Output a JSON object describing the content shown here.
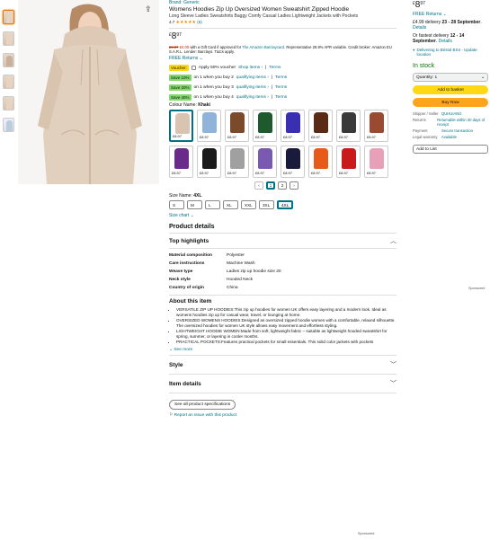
{
  "product": {
    "brand": "Brand: Generic",
    "title": "Womens Hoodies Zip Up Oversized Women Sweatshirt Zipped Hoodie",
    "subtitle": "Long Sleeve Ladies Sweatshirts Baggy Comfy Casual Ladies Lightweight Jackets with Pockets",
    "rating_value": "4.7",
    "rating_count": "(6)",
    "price_symbol": "£",
    "price_whole": "8",
    "price_fraction": "97",
    "giftcard_old": "£8.97",
    "giftcard_new": "£0.00",
    "giftcard_text": "with a Gift Card if approved for",
    "giftcard_link": "The Amazon Barclaycard",
    "giftcard_tail": ". Representative 28.9% APR variable. Credit broker: Amazon EU S.A.R.L. Lender: Barclays. T&Cs apply.",
    "returns": "FREE Returns"
  },
  "promos": [
    {
      "badge": "Voucher:",
      "type": "voucher",
      "text": "Apply 50% voucher",
      "link1": "Shop items ›",
      "link2": "Terms"
    },
    {
      "badge": "Save 10%",
      "type": "save",
      "text": "on 1 when you buy 2",
      "link1": "qualifying items ›",
      "link2": "Terms"
    },
    {
      "badge": "Save 20%",
      "type": "save",
      "text": "on 1 when you buy 3",
      "link1": "qualifying items ›",
      "link2": "Terms"
    },
    {
      "badge": "Save 40%",
      "type": "save",
      "text": "on 1 when you buy 4",
      "link1": "qualifying items ›",
      "link2": "Terms"
    }
  ],
  "colour": {
    "label": "Colour Name:",
    "value": "Khaki"
  },
  "swatches": [
    {
      "color": "#d9c4b0",
      "price": "£8.97"
    },
    {
      "color": "#8fb3d9",
      "price": "£8.97"
    },
    {
      "color": "#7a4a2a",
      "price": "£8.97"
    },
    {
      "color": "#1f5a2e",
      "price": "£8.97"
    },
    {
      "color": "#3a2fb0",
      "price": "£8.97"
    },
    {
      "color": "#5a2a15",
      "price": "£8.97"
    },
    {
      "color": "#3a3a3a",
      "price": "£8.97"
    },
    {
      "color": "#9a4a30",
      "price": "£8.97"
    },
    {
      "color": "#6a2a8a",
      "price": "£8.97"
    },
    {
      "color": "#1a1a1a",
      "price": "£8.97"
    },
    {
      "color": "#a0a0a0",
      "price": "£8.97"
    },
    {
      "color": "#7a5ab0",
      "price": "£8.97"
    },
    {
      "color": "#1a1a3a",
      "price": "£8.97"
    },
    {
      "color": "#e85a1a",
      "price": "£8.97"
    },
    {
      "color": "#c81a1a",
      "price": "£8.97"
    },
    {
      "color": "#e8a0b8",
      "price": "£8.97"
    }
  ],
  "pager": {
    "prev": "‹",
    "pages": [
      "1",
      "2"
    ],
    "next": "›"
  },
  "size": {
    "label": "Size Name:",
    "value": "4XL",
    "options": [
      "S",
      "M",
      "L",
      "XL",
      "XXL",
      "3XL",
      "4XL"
    ],
    "chart": "Size chart"
  },
  "details": {
    "heading": "Product details",
    "top_highlights": "Top highlights",
    "rows": [
      {
        "k": "Material composition",
        "v": "Polyester"
      },
      {
        "k": "Care instructions",
        "v": "Machine Wash"
      },
      {
        "k": "Weave type",
        "v": "Ladies zip up hoodie size 20"
      },
      {
        "k": "Neck style",
        "v": "Hooded Neck"
      },
      {
        "k": "Country of origin",
        "v": "China"
      }
    ],
    "sponsored": "Sponsored"
  },
  "about": {
    "heading": "About this item",
    "bullets": [
      "VERSATILE ZIP UP HOODIES:This zip up hoodies for women UK offers easy layering and a modern look. Ideal as womens hoodies zip up for casual wear, travel, or lounging at home.",
      "OVERSIZED WOMENS HOODIES:Designed as oversized zipped hoodie women with a comfortable, relaxed silhouette. The oversized hoodies for women UK style allows easy movement and effortless styling.",
      "LIGHTWEIGHT HOODIE WOMEN:Made from soft, lightweight fabric – suitable as lightweight hooded sweatshirt for spring, summer, or layering in cooler months.",
      "PRACTICAL POCKETS:Features practical pockets for small essentials. This solid color jackets with pockets"
    ],
    "see_more": "See more"
  },
  "sections": {
    "style": "Style",
    "item_details": "Item details"
  },
  "spec_button": "See all product specifications",
  "report": "Report an issue with this product",
  "sponsored_bottom": "Sponsored",
  "buybox": {
    "price_symbol": "£",
    "price_whole": "8",
    "price_fraction": "97",
    "returns": "FREE Returns",
    "delivery_pre": "£4.99 delivery",
    "delivery_date": "23 - 28 September",
    "delivery_link": "Details",
    "fast_pre": "Or fastest delivery",
    "fast_date": "12 - 14 September",
    "fast_link": "Details",
    "location": "Delivering to Bristol BS4 - Update location",
    "stock": "In stock",
    "quantity": "Quantity: 1",
    "add_basket": "Add to basket",
    "buy_now": "Buy Now",
    "info": [
      {
        "k": "Shipper / Seller",
        "v": "QUHUIANG"
      },
      {
        "k": "Returns",
        "v": "Returnable within 30 days of receipt"
      },
      {
        "k": "Payment",
        "v": "Secure transaction"
      },
      {
        "k": "Legal warranty",
        "v": "Available"
      }
    ],
    "add_list": "Add to List"
  }
}
